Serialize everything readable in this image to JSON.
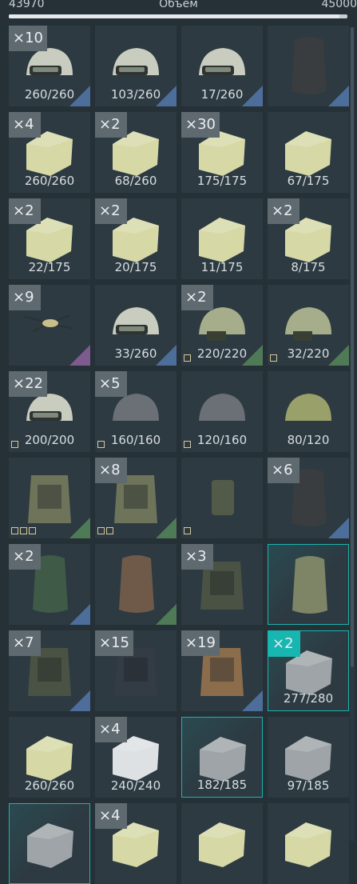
{
  "capacity": {
    "current": "43970",
    "label": "Объем",
    "max": "45000",
    "fill_fraction": 0.977
  },
  "colors": {
    "rarity_blue": "#4d6e9a",
    "rarity_green": "#4f7a56",
    "rarity_purple": "#7d5b8f",
    "highlight_teal": "#17b6b1"
  },
  "items": [
    {
      "count": "×10",
      "durability": "260/260",
      "icon": "helmet-visor-icon",
      "rarity": "blue"
    },
    {
      "count": "",
      "durability": "103/260",
      "icon": "helmet-visor-icon",
      "rarity": "blue"
    },
    {
      "count": "",
      "durability": "17/260",
      "icon": "helmet-visor-icon",
      "rarity": "blue"
    },
    {
      "count": "",
      "durability": "",
      "icon": "backpack-icon",
      "rarity": "blue"
    },
    {
      "count": "×4",
      "durability": "260/260",
      "icon": "armor-plate-icon",
      "rarity": ""
    },
    {
      "count": "×2",
      "durability": "68/260",
      "icon": "armor-plate-icon",
      "rarity": ""
    },
    {
      "count": "×30",
      "durability": "175/175",
      "icon": "armor-plate-icon",
      "rarity": ""
    },
    {
      "count": "",
      "durability": "67/175",
      "icon": "armor-plate-icon",
      "rarity": ""
    },
    {
      "count": "×2",
      "durability": "22/175",
      "icon": "armor-plate-icon",
      "rarity": ""
    },
    {
      "count": "×2",
      "durability": "20/175",
      "icon": "armor-plate-icon",
      "rarity": ""
    },
    {
      "count": "",
      "durability": "11/175",
      "icon": "armor-plate-icon",
      "rarity": ""
    },
    {
      "count": "×2",
      "durability": "8/175",
      "icon": "armor-plate-icon",
      "rarity": ""
    },
    {
      "count": "×9",
      "durability": "",
      "icon": "drone-icon",
      "rarity": "purple"
    },
    {
      "count": "",
      "durability": "33/260",
      "icon": "helmet-visor-icon",
      "rarity": "blue"
    },
    {
      "count": "×2",
      "durability": "220/220",
      "icon": "tactical-helmet-icon",
      "rarity": "green",
      "mods": 1
    },
    {
      "count": "",
      "durability": "32/220",
      "icon": "tactical-helmet-icon",
      "rarity": "green",
      "mods": 1
    },
    {
      "count": "×22",
      "durability": "200/200",
      "icon": "helmet-goggles-icon",
      "rarity": "",
      "mods": 1
    },
    {
      "count": "×5",
      "durability": "160/160",
      "icon": "ballistic-helmet-icon",
      "rarity": "",
      "mods": 1
    },
    {
      "count": "",
      "durability": "120/160",
      "icon": "ballistic-helmet-icon",
      "rarity": "",
      "mods": 1
    },
    {
      "count": "",
      "durability": "80/120",
      "icon": "steel-helmet-icon",
      "rarity": ""
    },
    {
      "count": "",
      "durability": "",
      "icon": "chest-rig-icon",
      "rarity": "green",
      "mods": 3
    },
    {
      "count": "×8",
      "durability": "",
      "icon": "chest-rig-icon",
      "rarity": "green",
      "mods": 2
    },
    {
      "count": "",
      "durability": "",
      "icon": "pouch-icon",
      "rarity": "",
      "mods": 1
    },
    {
      "count": "×6",
      "durability": "",
      "icon": "backpack-icon",
      "rarity": "blue"
    },
    {
      "count": "×2",
      "durability": "",
      "icon": "backpack-green-icon",
      "rarity": "blue"
    },
    {
      "count": "",
      "durability": "",
      "icon": "sack-icon",
      "rarity": "green"
    },
    {
      "count": "×3",
      "durability": "",
      "icon": "tactical-vest-icon",
      "rarity": ""
    },
    {
      "count": "",
      "durability": "",
      "icon": "bag-icon",
      "rarity": "",
      "highlight": true
    },
    {
      "count": "×7",
      "durability": "",
      "icon": "armor-vest-icon",
      "rarity": "blue"
    },
    {
      "count": "×15",
      "durability": "",
      "icon": "armor-vest-dark-icon",
      "rarity": ""
    },
    {
      "count": "×19",
      "durability": "",
      "icon": "armor-vest-tan-icon",
      "rarity": "blue"
    },
    {
      "count": "×2",
      "durability": "277/280",
      "icon": "steel-plate-icon",
      "rarity": "",
      "highlight": true,
      "teal": true
    },
    {
      "count": "",
      "durability": "260/260",
      "icon": "armor-plate-icon",
      "rarity": ""
    },
    {
      "count": "×4",
      "durability": "240/240",
      "icon": "white-plate-icon",
      "rarity": ""
    },
    {
      "count": "",
      "durability": "182/185",
      "icon": "steel-plate-icon",
      "rarity": "",
      "highlight": true
    },
    {
      "count": "",
      "durability": "97/185",
      "icon": "steel-plate-icon",
      "rarity": ""
    },
    {
      "count": "",
      "durability": "",
      "icon": "steel-plate-icon",
      "rarity": "",
      "highlight": true
    },
    {
      "count": "×4",
      "durability": "",
      "icon": "armor-plate-icon",
      "rarity": ""
    },
    {
      "count": "",
      "durability": "",
      "icon": "armor-plate-icon",
      "rarity": ""
    },
    {
      "count": "",
      "durability": "",
      "icon": "armor-plate-icon",
      "rarity": ""
    }
  ]
}
